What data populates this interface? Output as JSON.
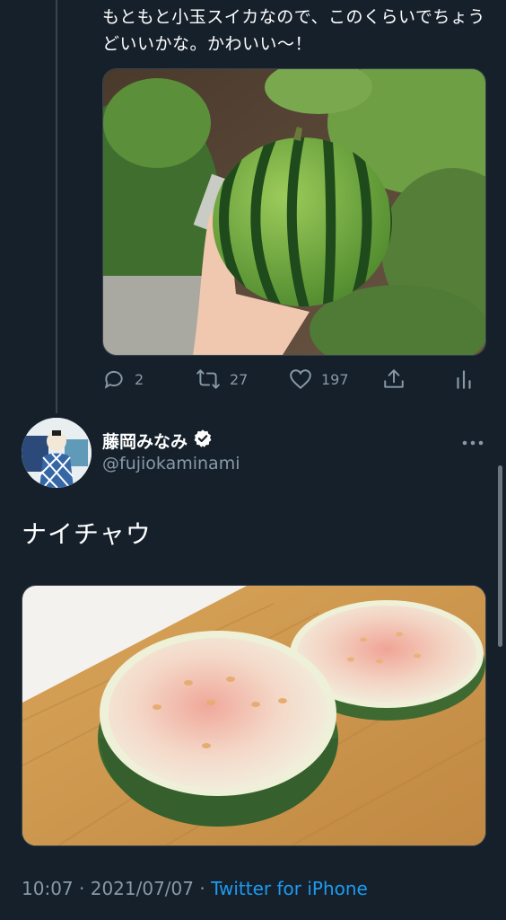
{
  "thread": {
    "previous_tweet": {
      "text": "もともと小玉スイカなので、このくらいでちょうどいいかな。かわいい〜！",
      "image_alt": "",
      "stats": {
        "replies": "2",
        "retweets": "27",
        "likes": "197"
      }
    },
    "main_tweet": {
      "display_name": "藤岡みなみ",
      "handle": "@fujiokaminami",
      "text": "ナイチャウ",
      "time": "10:07",
      "date": "2021/07/07",
      "separator": "·",
      "source": "Twitter for iPhone"
    }
  },
  "icons": {
    "reply": "reply-icon",
    "retweet": "retweet-icon",
    "like": "heart-icon",
    "share": "share-icon",
    "stats": "analytics-icon",
    "verified": "verified-badge-icon",
    "more": "more-icon"
  },
  "colors": {
    "background": "#15202b",
    "text": "#ffffff",
    "secondary": "#8899a6",
    "link": "#1d9bf0",
    "divider": "#38444d"
  }
}
